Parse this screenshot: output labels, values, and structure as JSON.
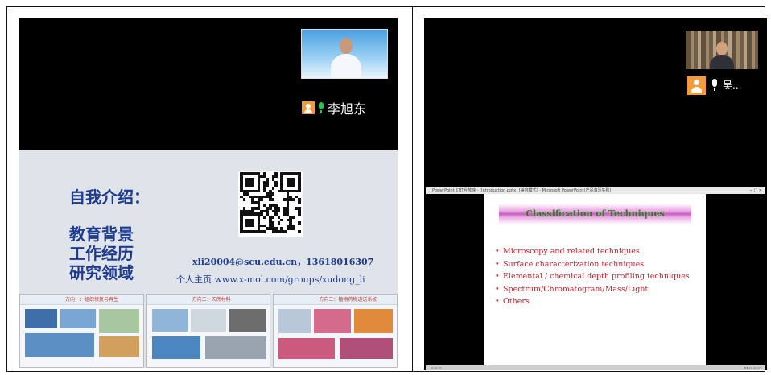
{
  "left": {
    "speaker_name": "李旭东",
    "slide": {
      "heading": "自我介绍：",
      "lines": [
        "教育背景",
        "工作经历",
        "研究领域"
      ],
      "contact": "xli20004@scu.edu.cn，13618016307",
      "homepage": "个人主页 www.x-mol.com/groups/xudong_li"
    },
    "thumbnails": [
      {
        "title": "方向一：组织修复与再生"
      },
      {
        "title": "方向二：天然材料"
      },
      {
        "title": "方向三：植物药物递送系统"
      }
    ]
  },
  "right": {
    "participant_name": "吴...",
    "ppt_title": "PowerPoint 幻灯片放映 - [Introduction.pptx] [兼容模式] - Microsoft PowerPoint(产品激活失败)",
    "slide": {
      "title": "Classification of Techniques",
      "bullets": [
        "Microscopy and related techniques",
        "Surface characterization techniques",
        "Elemental / chemical depth profiling techniques",
        "Spectrum/Chromatogram/Mass/Light",
        "Others"
      ]
    },
    "bullet_glyph": "•"
  },
  "colors": {
    "slide_text": "#1f3b8f",
    "bullet_text": "#c0232f",
    "title_text": "#2e7d1e",
    "avatar": "#f39a3a",
    "mic_active": "#2ec24a"
  }
}
